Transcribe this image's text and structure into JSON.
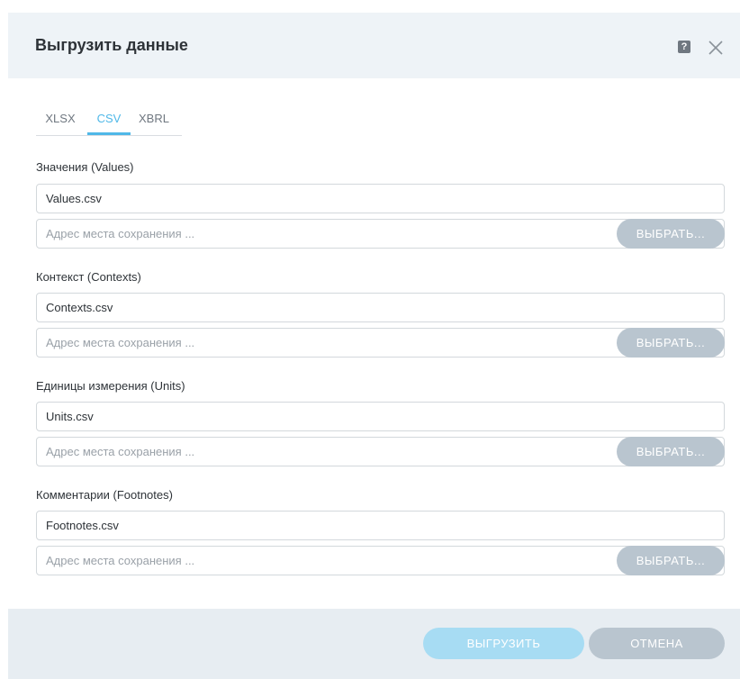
{
  "dialog": {
    "title": "Выгрузить данные",
    "help_icon": "?",
    "close_icon": "close-icon"
  },
  "tabs": [
    {
      "label": "XLSX",
      "active": false
    },
    {
      "label": "CSV",
      "active": true
    },
    {
      "label": "XBRL",
      "active": false
    }
  ],
  "sections": [
    {
      "label": "Значения (Values)",
      "file_name": "Values.csv",
      "path_value": "",
      "path_placeholder": "Адрес места сохранения ...",
      "browse_label": "ВЫБРАТЬ..."
    },
    {
      "label": "Контекст (Contexts)",
      "file_name": "Contexts.csv",
      "path_value": "",
      "path_placeholder": "Адрес места сохранения ...",
      "browse_label": "ВЫБРАТЬ..."
    },
    {
      "label": "Единицы измерения (Units)",
      "file_name": "Units.csv",
      "path_value": "",
      "path_placeholder": "Адрес места сохранения ...",
      "browse_label": "ВЫБРАТЬ..."
    },
    {
      "label": "Комментарии (Footnotes)",
      "file_name": "Footnotes.csv",
      "path_value": "",
      "path_placeholder": "Адрес места сохранения ...",
      "browse_label": "ВЫБРАТЬ..."
    }
  ],
  "footer": {
    "export_label": "ВЫГРУЗИТЬ",
    "export_enabled": false,
    "cancel_label": "ОТМЕНА"
  },
  "colors": {
    "accent": "#4fb8e8",
    "header_bg": "#eef3f7",
    "footer_bg": "#e7edf2",
    "button_disabled": "#b9c5cf",
    "export_disabled": "#a7dcf3"
  }
}
